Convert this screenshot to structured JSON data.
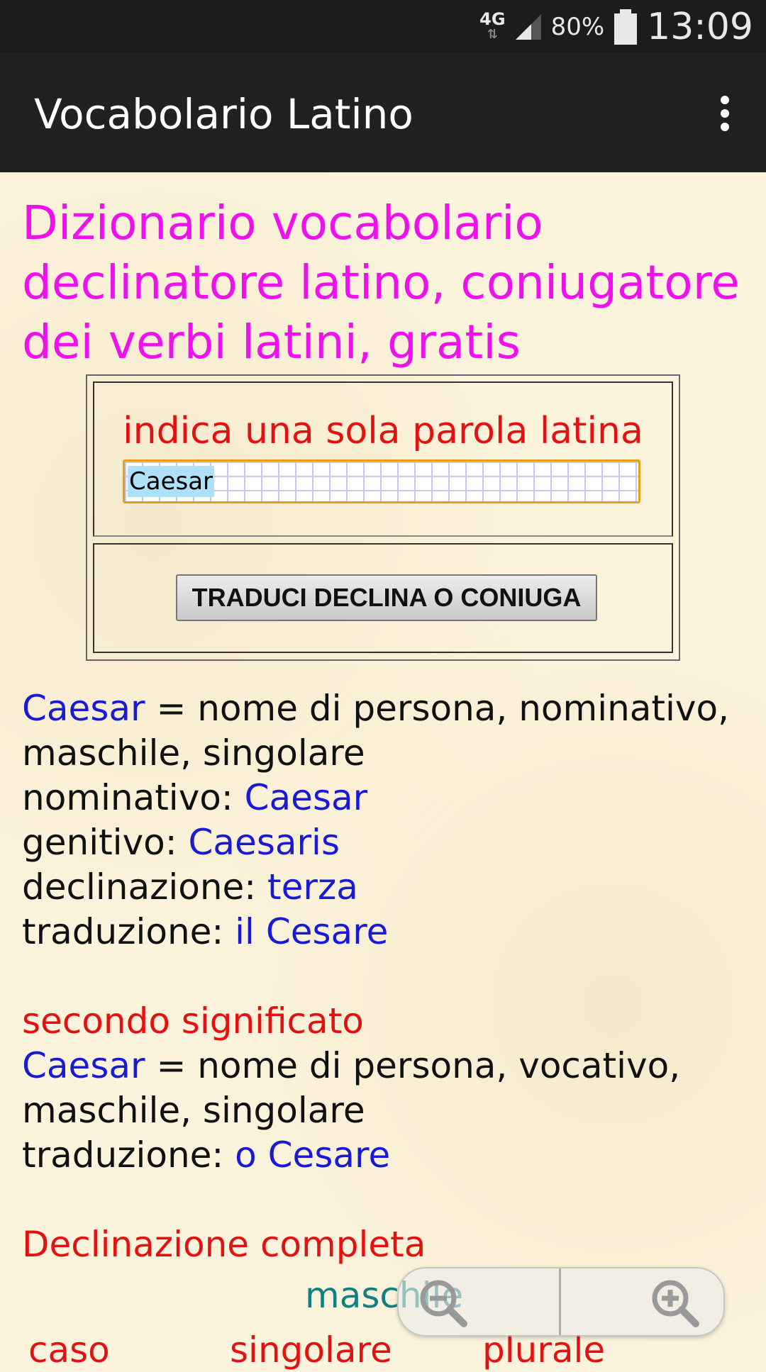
{
  "status_bar": {
    "network": "4G",
    "battery_percent": "80%",
    "time": "13:09"
  },
  "app_bar": {
    "title": "Vocabolario Latino"
  },
  "page": {
    "heading": "Dizionario vocabolario declinatore latino, coniugatore dei verbi latini, gratis",
    "form": {
      "prompt": "indica una sola parola latina",
      "input_value": "Caesar",
      "button_label": "TRADUCI DECLINA O CONIUGA"
    },
    "result": {
      "word": "Caesar",
      "description": " = nome di persona, nominativo, maschile, singolare",
      "lines": [
        {
          "label": "nominativo: ",
          "value": "Caesar"
        },
        {
          "label": "genitivo: ",
          "value": "Caesaris"
        },
        {
          "label": "declinazione: ",
          "value": "terza"
        },
        {
          "label": "traduzione: ",
          "value": "il Cesare"
        }
      ]
    },
    "second_meaning": {
      "heading": "secondo significato",
      "word": "Caesar",
      "description": " = nome di persona, vocativo, maschile, singolare",
      "translation_label": "traduzione: ",
      "translation_value": "o Cesare"
    },
    "declension": {
      "heading": "Declinazione completa",
      "gender": "maschile",
      "columns": [
        "caso",
        "singolare",
        "plurale"
      ]
    }
  },
  "icons": {
    "overflow": "more-vert-icon",
    "zoom_out": "zoom-out-icon",
    "zoom_in": "zoom-in-icon",
    "signal": "signal-icon",
    "battery": "battery-icon"
  }
}
